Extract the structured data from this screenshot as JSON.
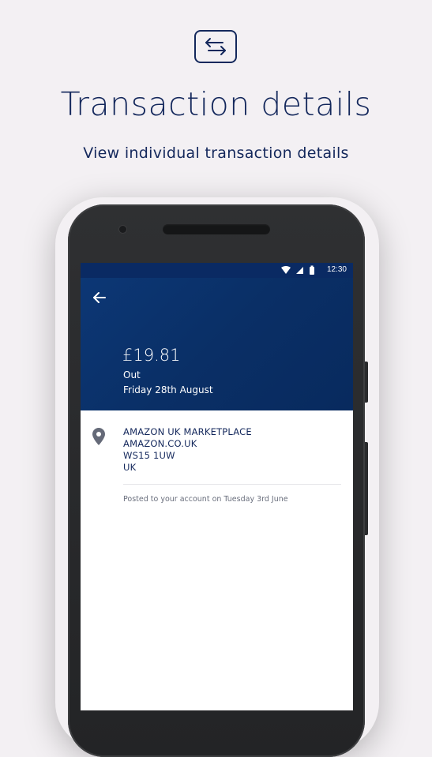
{
  "promo": {
    "icon": "swap-arrows-icon",
    "title": "Transaction details",
    "subtitle": "View individual transaction details"
  },
  "status_bar": {
    "time": "12:30",
    "icons": [
      "wifi-icon",
      "signal-icon",
      "battery-icon"
    ]
  },
  "header": {
    "back_icon": "arrow-left-icon",
    "amount": "£19.81",
    "direction": "Out",
    "date": "Friday 28th August"
  },
  "merchant": {
    "icon": "location-pin-icon",
    "lines": [
      "AMAZON UK MARKETPLACE",
      "AMAZON.CO.UK",
      "WS15 1UW",
      "UK"
    ]
  },
  "posted_text": "Posted to your account on Tuesday 3rd June",
  "colors": {
    "brand_navy": "#14285c",
    "header_blue": "#0a2f66",
    "background": "#f3f0f3"
  }
}
